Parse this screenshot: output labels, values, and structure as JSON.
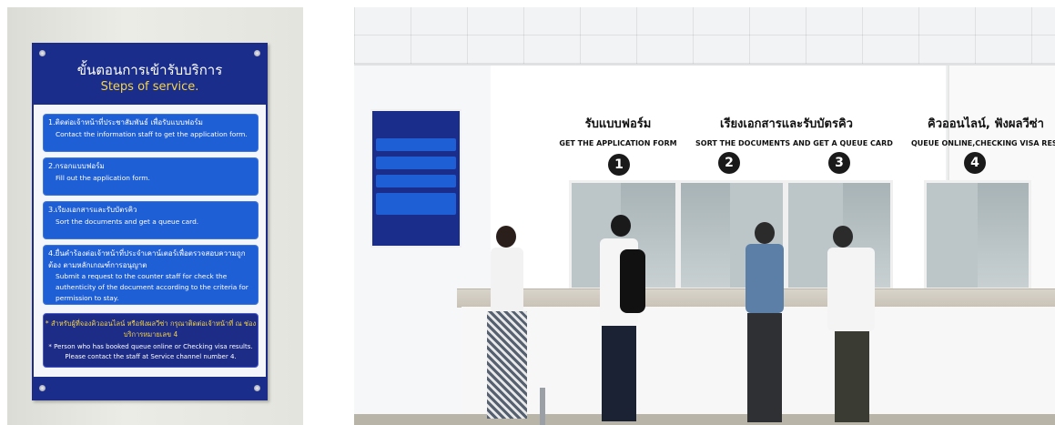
{
  "left_sign": {
    "title_th": "ขั้นตอนการเข้ารับบริการ",
    "title_en": "Steps of service.",
    "steps": [
      {
        "th": "1.ติดต่อเจ้าหน้าที่ประชาสัมพันธ์ เพื่อรับแบบฟอร์ม",
        "en": "Contact the information staff to get the application form."
      },
      {
        "th": "2.กรอกแบบฟอร์ม",
        "en": "Fill out the application form."
      },
      {
        "th": "3.เรียงเอกสารและรับบัตรคิว",
        "en": "Sort the documents and get a queue card."
      },
      {
        "th": "4.ยื่นคำร้องต่อเจ้าหน้าที่ประจำเคาน์เตอร์เพื่อตรวจสอบความถูกต้อง ตามหลักเกณฑ์การอนุญาต",
        "en": "Submit a request to the counter staff for check the authenticity of the document according to the criteria for permission to stay."
      }
    ],
    "note_th": "* สำหรับผู้ที่จองคิวออนไลน์ หรือฟังผลวีซ่า กรุณาติดต่อเจ้าหน้าที่ ณ ช่องบริการหมายเลข 4",
    "note_en": "* Person who has booked queue online or Checking visa results. Please contact the staff at Service channel number 4."
  },
  "counters": [
    {
      "title_th": "รับแบบฟอร์ม",
      "title_en": "GET THE APPLICATION FORM"
    },
    {
      "title_th": "เรียงเอกสารและรับบัตรคิว",
      "title_en": "SORT THE DOCUMENTS AND GET A QUEUE CARD"
    },
    {
      "title_th": "คิวออนไลน์, ฟังผลวีซ่า",
      "title_en": "QUEUE ONLINE,CHECKING VISA RESULT"
    }
  ],
  "counter_numbers": [
    "1",
    "2",
    "3",
    "4"
  ],
  "colors": {
    "sign_blue": "#1a2d8a",
    "step_blue": "#1f5fd6",
    "title_yellow": "#f5d44a"
  }
}
